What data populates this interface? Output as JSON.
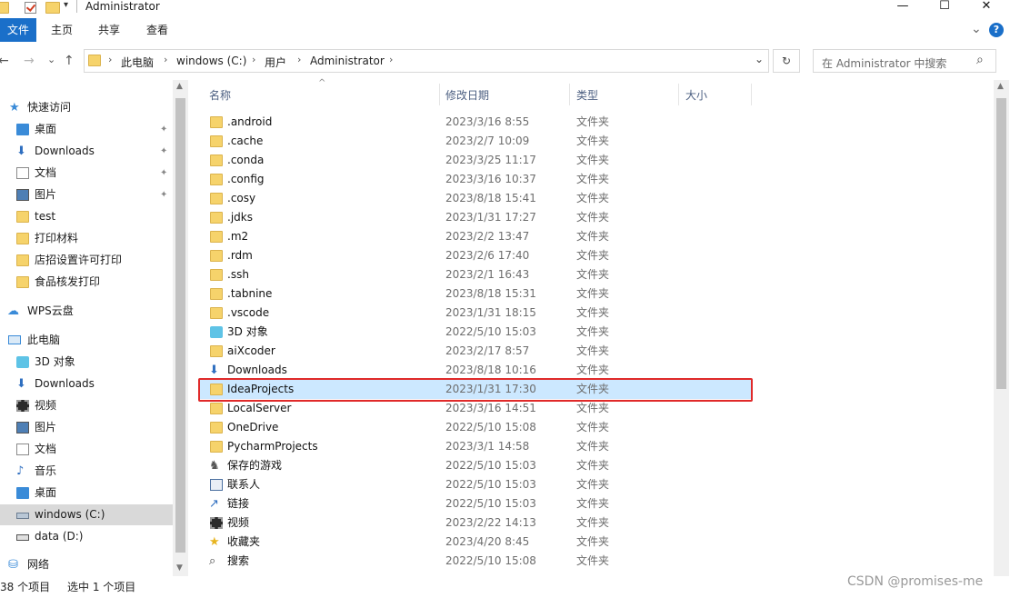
{
  "window": {
    "title": "Administrator",
    "minimize_glyph": "—",
    "maximize_glyph": "☐",
    "close_glyph": "✕"
  },
  "ribbon": {
    "tabs": [
      "文件",
      "主页",
      "共享",
      "查看"
    ],
    "expand_glyph": "⌄",
    "help_glyph": "?"
  },
  "address": {
    "back_glyph": "←",
    "forward_glyph": "→",
    "recent_glyph": "⌄",
    "up_glyph": "↑",
    "crumbs": [
      "此电脑",
      "windows (C:)",
      "用户",
      "Administrator"
    ],
    "dropdown_glyph": "⌄",
    "refresh_glyph": "↻"
  },
  "search": {
    "placeholder": "在 Administrator 中搜索",
    "icon_glyph": "⌕"
  },
  "nav": {
    "quick_access": "快速访问",
    "quick_items": [
      {
        "label": "桌面",
        "icon": "desktop-icon"
      },
      {
        "label": "Downloads",
        "icon": "download-icon"
      },
      {
        "label": "文档",
        "icon": "documents-icon"
      },
      {
        "label": "图片",
        "icon": "pictures-icon"
      },
      {
        "label": "test",
        "icon": "folder-icon"
      },
      {
        "label": "打印材料",
        "icon": "folder-icon"
      },
      {
        "label": "店招设置许可打印",
        "icon": "folder-icon"
      },
      {
        "label": "食品核发打印",
        "icon": "folder-icon"
      }
    ],
    "wps": "WPS云盘",
    "this_pc": "此电脑",
    "pc_items": [
      {
        "label": "3D 对象",
        "icon": "3d-objects-icon"
      },
      {
        "label": "Downloads",
        "icon": "download-icon"
      },
      {
        "label": "视频",
        "icon": "videos-icon"
      },
      {
        "label": "图片",
        "icon": "pictures-icon"
      },
      {
        "label": "文档",
        "icon": "documents-icon"
      },
      {
        "label": "音乐",
        "icon": "music-icon"
      },
      {
        "label": "桌面",
        "icon": "desktop-icon"
      },
      {
        "label": "windows (C:)",
        "icon": "drive-c-icon"
      },
      {
        "label": "data (D:)",
        "icon": "drive-icon"
      }
    ],
    "network": "网络",
    "pin_glyph": "📌"
  },
  "columns": {
    "name": "名称",
    "date": "修改日期",
    "type": "类型",
    "size": "大小",
    "sort_glyph": "^"
  },
  "files": [
    {
      "name": ".android",
      "date": "2023/3/16 8:55",
      "type": "文件夹",
      "icon": "folder-icon"
    },
    {
      "name": ".cache",
      "date": "2023/2/7 10:09",
      "type": "文件夹",
      "icon": "folder-icon"
    },
    {
      "name": ".conda",
      "date": "2023/3/25 11:17",
      "type": "文件夹",
      "icon": "folder-icon"
    },
    {
      "name": ".config",
      "date": "2023/3/16 10:37",
      "type": "文件夹",
      "icon": "folder-icon"
    },
    {
      "name": ".cosy",
      "date": "2023/8/18 15:41",
      "type": "文件夹",
      "icon": "folder-icon"
    },
    {
      "name": ".jdks",
      "date": "2023/1/31 17:27",
      "type": "文件夹",
      "icon": "folder-icon"
    },
    {
      "name": ".m2",
      "date": "2023/2/2 13:47",
      "type": "文件夹",
      "icon": "folder-icon"
    },
    {
      "name": ".rdm",
      "date": "2023/2/6 17:40",
      "type": "文件夹",
      "icon": "folder-icon"
    },
    {
      "name": ".ssh",
      "date": "2023/2/1 16:43",
      "type": "文件夹",
      "icon": "folder-icon"
    },
    {
      "name": ".tabnine",
      "date": "2023/8/18 15:31",
      "type": "文件夹",
      "icon": "folder-icon"
    },
    {
      "name": ".vscode",
      "date": "2023/1/31 18:15",
      "type": "文件夹",
      "icon": "folder-icon"
    },
    {
      "name": "3D 对象",
      "date": "2022/5/10 15:03",
      "type": "文件夹",
      "icon": "3d-objects-icon"
    },
    {
      "name": "aiXcoder",
      "date": "2023/2/17 8:57",
      "type": "文件夹",
      "icon": "folder-icon"
    },
    {
      "name": "Downloads",
      "date": "2023/8/18 10:16",
      "type": "文件夹",
      "icon": "download-icon"
    },
    {
      "name": "IdeaProjects",
      "date": "2023/1/31 17:30",
      "type": "文件夹",
      "icon": "folder-icon",
      "selected": true
    },
    {
      "name": "LocalServer",
      "date": "2023/3/16 14:51",
      "type": "文件夹",
      "icon": "folder-icon"
    },
    {
      "name": "OneDrive",
      "date": "2022/5/10 15:08",
      "type": "文件夹",
      "icon": "folder-icon"
    },
    {
      "name": "PycharmProjects",
      "date": "2023/3/1 14:58",
      "type": "文件夹",
      "icon": "folder-icon"
    },
    {
      "name": "保存的游戏",
      "date": "2022/5/10 15:03",
      "type": "文件夹",
      "icon": "saved-games-icon"
    },
    {
      "name": "联系人",
      "date": "2022/5/10 15:03",
      "type": "文件夹",
      "icon": "contacts-icon"
    },
    {
      "name": "链接",
      "date": "2022/5/10 15:03",
      "type": "文件夹",
      "icon": "links-icon"
    },
    {
      "name": "视频",
      "date": "2023/2/22 14:13",
      "type": "文件夹",
      "icon": "videos-icon"
    },
    {
      "name": "收藏夹",
      "date": "2023/4/20 8:45",
      "type": "文件夹",
      "icon": "favorites-icon"
    },
    {
      "name": "搜索",
      "date": "2022/5/10 15:08",
      "type": "文件夹",
      "icon": "search-icon"
    }
  ],
  "status": {
    "item_count": "38 个项目",
    "selected": "选中 1 个项目"
  },
  "watermark": "CSDN @promises-me"
}
